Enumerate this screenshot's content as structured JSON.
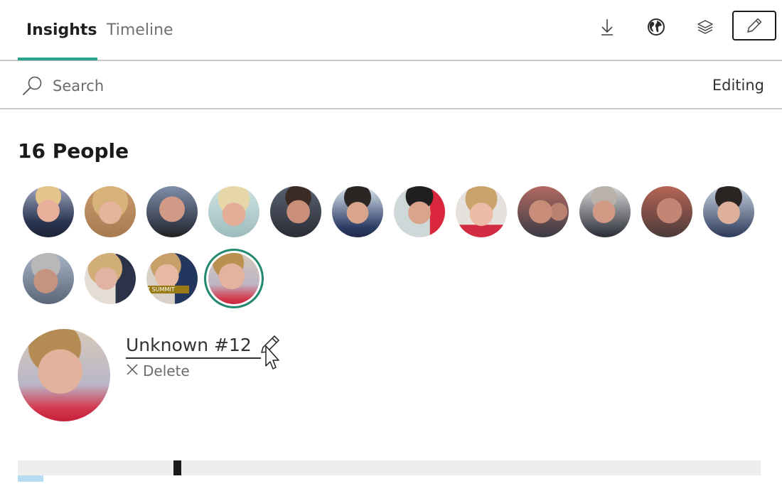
{
  "tabs": [
    {
      "label": "Insights",
      "active": true
    },
    {
      "label": "Timeline",
      "active": false
    }
  ],
  "toolbar": {
    "download_icon": "download-icon",
    "globe_icon": "globe-icon",
    "layers_icon": "layers-icon",
    "edit_icon": "pencil-icon",
    "edit_active": true
  },
  "search": {
    "placeholder": "Search",
    "value": "",
    "mode_label": "Editing"
  },
  "people": {
    "title": "16 People",
    "faces": [
      {
        "id": 1,
        "selected": false
      },
      {
        "id": 2,
        "selected": false
      },
      {
        "id": 3,
        "selected": false
      },
      {
        "id": 4,
        "selected": false
      },
      {
        "id": 5,
        "selected": false
      },
      {
        "id": 6,
        "selected": false
      },
      {
        "id": 7,
        "selected": false
      },
      {
        "id": 8,
        "selected": false
      },
      {
        "id": 9,
        "selected": false
      },
      {
        "id": 10,
        "selected": false
      },
      {
        "id": 11,
        "selected": false
      },
      {
        "id": 12,
        "selected": false
      },
      {
        "id": 13,
        "selected": false
      },
      {
        "id": 14,
        "selected": false
      },
      {
        "id": 15,
        "selected": false,
        "caption": "7 SUMMIT"
      },
      {
        "id": 16,
        "selected": true
      }
    ]
  },
  "selected_person": {
    "name": "Unknown #12",
    "delete_label": "Delete"
  },
  "timeline": {
    "marker_position": 0.21,
    "highlight": true
  },
  "colors": {
    "accent": "#2aa38a",
    "selected_ring": "#218a70",
    "timeline_bg": "#eeeeee",
    "timeline_highlight": "#b7dcf2"
  }
}
